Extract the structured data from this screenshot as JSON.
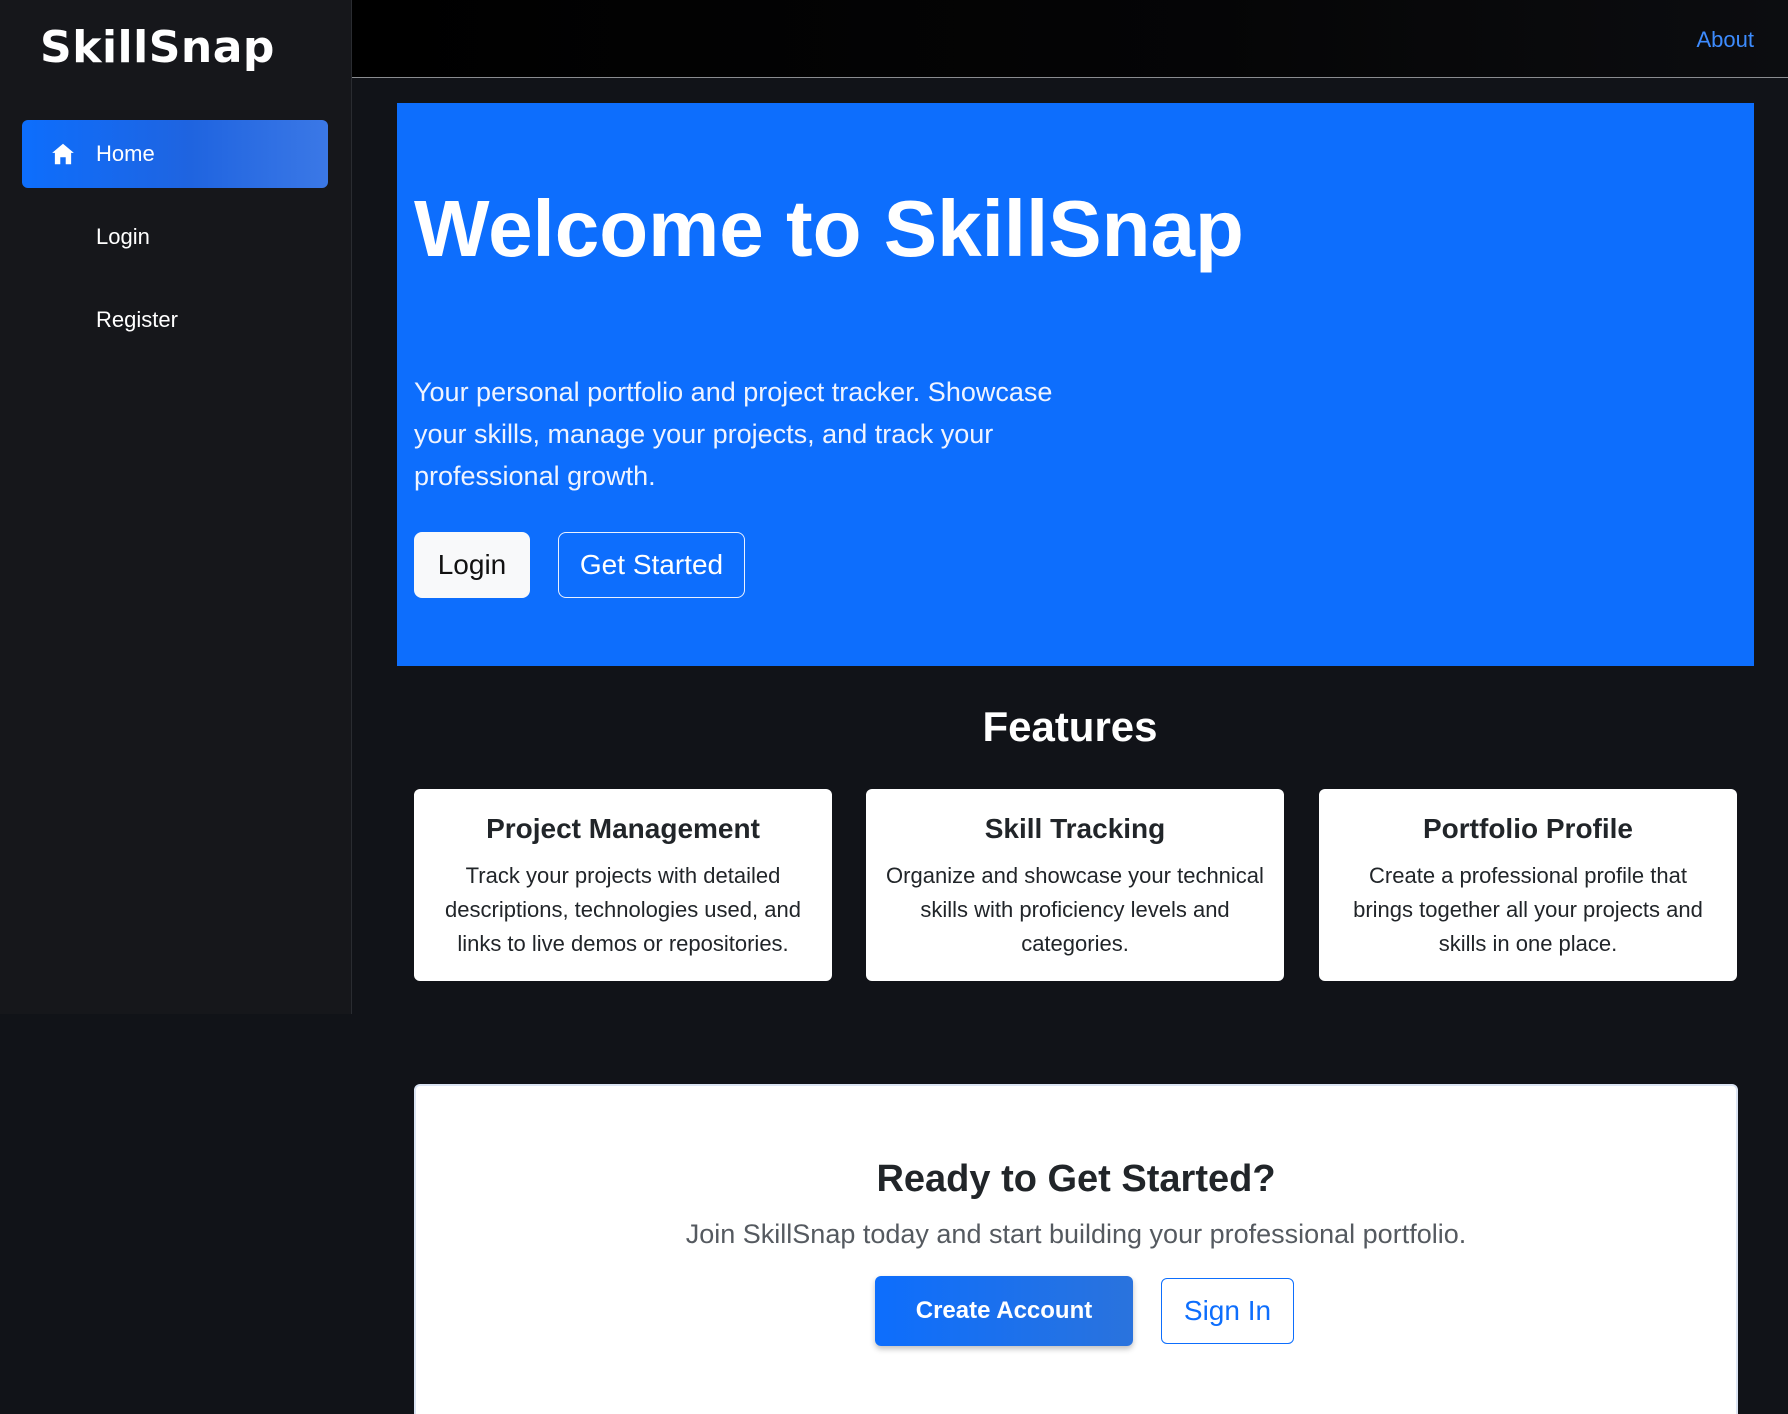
{
  "sidebar": {
    "brand": "SkillSnap",
    "items": [
      {
        "label": "Home",
        "icon": "home-icon",
        "active": true
      },
      {
        "label": "Login"
      },
      {
        "label": "Register"
      }
    ]
  },
  "topbar": {
    "about_label": "About"
  },
  "hero": {
    "title": "Welcome to SkillSnap",
    "subtitle": "Your personal portfolio and project tracker. Showcase your skills, manage your projects, and track your professional growth.",
    "login_label": "Login",
    "start_label": "Get Started"
  },
  "features": {
    "title": "Features",
    "cards": [
      {
        "title": "Project Management",
        "text": "Track your projects with detailed descriptions, technologies used, and links to live demos or repositories."
      },
      {
        "title": "Skill Tracking",
        "text": "Organize and showcase your technical skills with proficiency levels and categories."
      },
      {
        "title": "Portfolio Profile",
        "text": "Create a professional profile that brings together all your projects and skills in one place."
      }
    ]
  },
  "cta": {
    "title": "Ready to Get Started?",
    "text": "Join SkillSnap today and start building your professional portfolio.",
    "create_label": "Create Account",
    "signin_label": "Sign In"
  },
  "colors": {
    "primary": "#0d6efd",
    "background": "#111318",
    "sidebar": "#16171b"
  }
}
